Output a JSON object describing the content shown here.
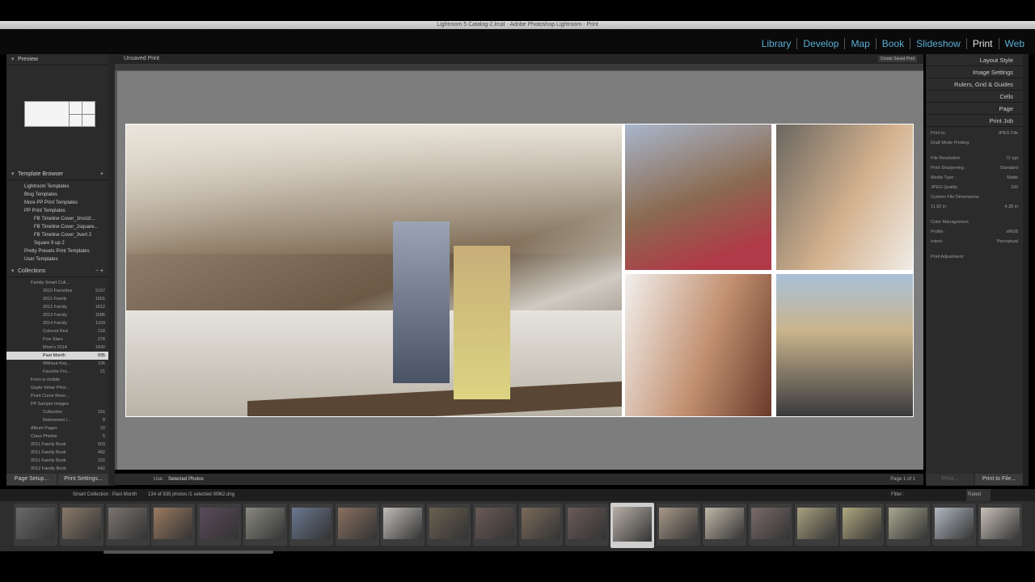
{
  "window": {
    "title": "Lightroom 5 Catalog-2.lrcat - Adobe Photoshop Lightroom - Print"
  },
  "modules": [
    "Library",
    "Develop",
    "Map",
    "Book",
    "Slideshow",
    "Print",
    "Web"
  ],
  "active_module": "Print",
  "left_panel": {
    "preview_label": "Preview",
    "template_browser": {
      "title": "Template Browser",
      "items": [
        "Lightroom Templates",
        "Blog Templates",
        "More PP Print Templates",
        "PP Print Templates",
        "FB Timeline Cover_1horizt...",
        "FB Timeline Cover_2square...",
        "FB Timeline Cover_3vert 2",
        "Square 9 up 2",
        "Pretty Presets Print Templates",
        "User Templates"
      ]
    },
    "collections": {
      "title": "Collections",
      "items": [
        {
          "name": "Family Smart Coll...",
          "count": ""
        },
        {
          "name": "2010 Favorites",
          "count": "2167"
        },
        {
          "name": "2011 Family",
          "count": "1601"
        },
        {
          "name": "2012 Family",
          "count": "1812"
        },
        {
          "name": "2013 Family",
          "count": "1586"
        },
        {
          "name": "2014 Family",
          "count": "1109"
        },
        {
          "name": "Colored Red",
          "count": "218"
        },
        {
          "name": "Five Stars",
          "count": "278"
        },
        {
          "name": "Mom's 2014",
          "count": "1430"
        },
        {
          "name": "Past Month",
          "count": "935"
        },
        {
          "name": "Without Key...",
          "count": "136"
        },
        {
          "name": "Favorite Fro...",
          "count": "21"
        },
        {
          "name": "From iz mobile",
          "count": ""
        },
        {
          "name": "Gayle Vehar Phot...",
          "count": ""
        },
        {
          "name": "Point Curve Reso...",
          "count": ""
        },
        {
          "name": "PP Sample Images",
          "count": ""
        },
        {
          "name": "Collection",
          "count": "316"
        },
        {
          "name": "Retirement I...",
          "count": "8"
        },
        {
          "name": "Album Pages",
          "count": "20"
        },
        {
          "name": "Class Photos",
          "count": "5"
        },
        {
          "name": "2011 Family Book",
          "count": "503"
        },
        {
          "name": "2011 Family Book",
          "count": "492"
        },
        {
          "name": "2011 Family Book",
          "count": "152"
        },
        {
          "name": "2012 Family Book",
          "count": "642"
        }
      ]
    },
    "page_setup": "Page Setup...",
    "print_settings": "Print Settings..."
  },
  "center": {
    "tab_label": "Unsaved Print",
    "create_saved": "Create Saved Print",
    "use_label": "Use:",
    "use_value": "Selected Photos",
    "page_label": "Page 1 of 1"
  },
  "right_panel": {
    "sections": [
      "Layout Style",
      "Image Settings",
      "Rulers, Grid & Guides",
      "Cells",
      "Page",
      "Print Job"
    ],
    "print_job": [
      {
        "label": "Print to:",
        "value": "JPEG File"
      },
      {
        "label": "Draft Mode Printing",
        "value": ""
      },
      {
        "label": "File Resolution",
        "value": "72 ppi"
      },
      {
        "label": "Print Sharpening :",
        "value": "Standard"
      },
      {
        "label": "Media Type :",
        "value": "Matte"
      },
      {
        "label": "JPEG Quality",
        "value": "100"
      },
      {
        "label": "Custom File Dimensions",
        "value": ""
      },
      {
        "label": "11.82 in",
        "value": "4.38 in"
      },
      {
        "label": "Color Management",
        "value": ""
      },
      {
        "label": "Profile :",
        "value": "sRGB"
      },
      {
        "label": "Intent :",
        "value": "Perceptual"
      },
      {
        "label": "Print Adjustment",
        "value": ""
      }
    ],
    "print_button": "Print...",
    "print_to_file": "Print to File..."
  },
  "filmstrip": {
    "source": "Smart Collection : Past Month",
    "status": "134 of 935 photos /1 selected /8962.dng",
    "filter_label": "Filter :",
    "filter_value": "Rated"
  }
}
